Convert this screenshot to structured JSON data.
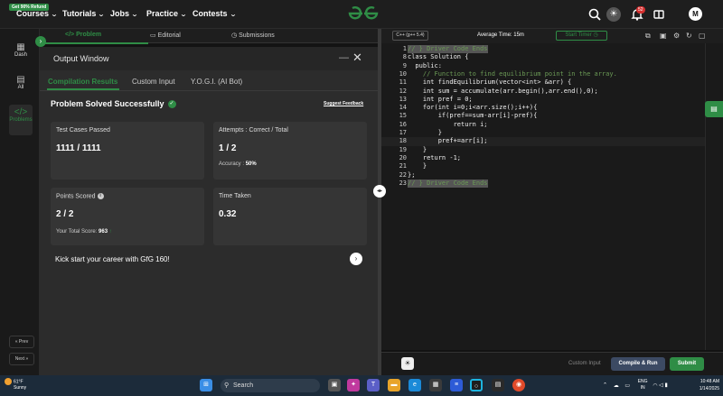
{
  "topnav": {
    "refund_badge": "Get 90% Refund",
    "items": [
      {
        "label": "Courses"
      },
      {
        "label": "Tutorials"
      },
      {
        "label": "Jobs"
      },
      {
        "label": "Practice"
      },
      {
        "label": "Contests"
      }
    ],
    "notification_count": "52",
    "avatar_initial": "M",
    "logo_icon": "gfg-logo",
    "brand_color": "#2f8d46"
  },
  "sidebar": {
    "items": [
      {
        "label": "Dash",
        "icon": "dashboard-icon"
      },
      {
        "label": "All",
        "icon": "grid-icon"
      },
      {
        "label": "Problems",
        "icon": "code-icon"
      }
    ],
    "prev_label": "« Prev",
    "next_label": "Next »"
  },
  "left_tabs": [
    {
      "label": "</>  Problem"
    },
    {
      "label": "Editorial"
    },
    {
      "label": "Submissions"
    }
  ],
  "output": {
    "title": "Output Window",
    "tabs": [
      {
        "label": "Compilation Results"
      },
      {
        "label": "Custom Input"
      },
      {
        "label": "Y.O.G.I. (AI Bot)"
      }
    ],
    "status": "Problem Solved Successfully",
    "suggest_feedback": "Suggest Feedback",
    "cards": {
      "test_cases": {
        "title": "Test Cases Passed",
        "value": "1111 / 1111"
      },
      "attempts": {
        "title": "Attempts : Correct / Total",
        "value": "1 / 2",
        "sub_label": "Accuracy :",
        "sub_value": "50%"
      },
      "points": {
        "title": "Points Scored",
        "value": "2 / 2",
        "sub_label": "Your Total Score:",
        "sub_value": "963"
      },
      "time": {
        "title": "Time Taken",
        "value": "0.32"
      }
    },
    "kickstart": "Kick start your career with GfG 160!"
  },
  "editor": {
    "language": "C++ (g++ 5.4)",
    "average_time": "Average Time: 15m",
    "start_timer": "Start Timer",
    "lines": [
      {
        "n": "1",
        "code": "// } Driver Code Ends"
      },
      {
        "n": "8",
        "code": "class Solution {"
      },
      {
        "n": "9",
        "code": "  public:"
      },
      {
        "n": "10",
        "code": "    // Function to find equilibrium point in the array."
      },
      {
        "n": "11",
        "code": "    int findEquilibrium(vector<int> &arr) {"
      },
      {
        "n": "12",
        "code": "    int sum = accumulate(arr.begin(),arr.end(),0);"
      },
      {
        "n": "13",
        "code": "    int pref = 0;"
      },
      {
        "n": "14",
        "code": "    for(int i=0;i<arr.size();i++){"
      },
      {
        "n": "15",
        "code": "        if(pref==sum-arr[i]-pref){"
      },
      {
        "n": "16",
        "code": "            return i;"
      },
      {
        "n": "17",
        "code": "        }"
      },
      {
        "n": "18",
        "code": "        pref+=arr[i];"
      },
      {
        "n": "19",
        "code": "    }"
      },
      {
        "n": "20",
        "code": "    return -1;"
      },
      {
        "n": "21",
        "code": "    }"
      },
      {
        "n": "22",
        "code": "};"
      },
      {
        "n": "23",
        "code": "// } Driver Code Ends"
      }
    ],
    "custom_input": "Custom Input",
    "compile_run": "Compile & Run",
    "submit": "Submit"
  },
  "taskbar": {
    "temperature": "61°F",
    "condition": "Sunny",
    "search_placeholder": "Search",
    "lang": "ENG",
    "region": "IN",
    "time": "10:48 AM",
    "date": "1/14/2025"
  }
}
